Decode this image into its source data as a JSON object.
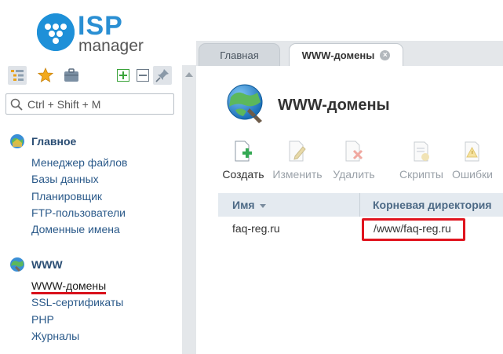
{
  "logo": {
    "brand": "ISP",
    "sub": "manager"
  },
  "sidebar": {
    "toolbar_icons": [
      "tree-view-icon",
      "star-icon",
      "briefcase-icon",
      "expand-all-icon",
      "collapse-all-icon",
      "pin-icon"
    ],
    "search": {
      "placeholder": "Ctrl + Shift + M"
    },
    "groups": [
      {
        "title": "Главное",
        "icon": "home-globe-icon",
        "items": [
          "Менеджер файлов",
          "Базы данных",
          "Планировщик",
          "FTP-пользователи",
          "Доменные имена"
        ]
      },
      {
        "title": "WWW",
        "icon": "www-globe-icon",
        "items": [
          "WWW-домены",
          "SSL-сертификаты",
          "PHP",
          "Журналы"
        ]
      }
    ]
  },
  "tabs": [
    {
      "label": "Главная"
    },
    {
      "label": "WWW-домены",
      "close": "×"
    }
  ],
  "page": {
    "title": "WWW-домены"
  },
  "toolbar": {
    "create": "Создать",
    "edit": "Изменить",
    "delete": "Удалить",
    "scripts": "Скрипты",
    "errors": "Ошибки"
  },
  "table": {
    "columns": [
      "Имя",
      "Корневая директория"
    ],
    "rows": [
      {
        "name": "faq-reg.ru",
        "root": "/www/faq-reg.ru"
      }
    ]
  },
  "colors": {
    "accent": "#2a8fd3",
    "highlight": "#e0141e",
    "link": "#2b5a8a"
  }
}
